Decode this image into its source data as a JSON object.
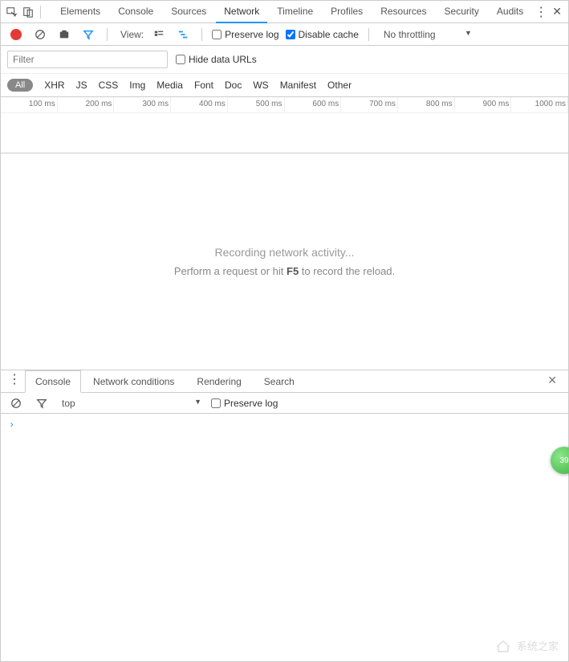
{
  "topTabs": [
    "Elements",
    "Console",
    "Sources",
    "Network",
    "Timeline",
    "Profiles",
    "Resources",
    "Security",
    "Audits"
  ],
  "activeTopTab": "Network",
  "netToolbar": {
    "viewLabel": "View:",
    "preserveLogLabel": "Preserve log",
    "disableCacheLabel": "Disable cache",
    "throttling": "No throttling"
  },
  "filter": {
    "placeholder": "Filter",
    "hideDataUrlsLabel": "Hide data URLs"
  },
  "typeFilters": {
    "all": "All",
    "items": [
      "XHR",
      "JS",
      "CSS",
      "Img",
      "Media",
      "Font",
      "Doc",
      "WS",
      "Manifest",
      "Other"
    ]
  },
  "timelineTicks": [
    "100 ms",
    "200 ms",
    "300 ms",
    "400 ms",
    "500 ms",
    "600 ms",
    "700 ms",
    "800 ms",
    "900 ms",
    "1000 ms"
  ],
  "empty": {
    "line1": "Recording network activity...",
    "line2_pre": "Perform a request or hit ",
    "line2_key": "F5",
    "line2_post": " to record the reload."
  },
  "drawer": {
    "tabs": [
      "Console",
      "Network conditions",
      "Rendering",
      "Search"
    ],
    "active": "Console"
  },
  "consoleBar": {
    "context": "top",
    "preserveLogLabel": "Preserve log"
  },
  "prompt": "›",
  "badge": "39",
  "watermark": "系统之家"
}
